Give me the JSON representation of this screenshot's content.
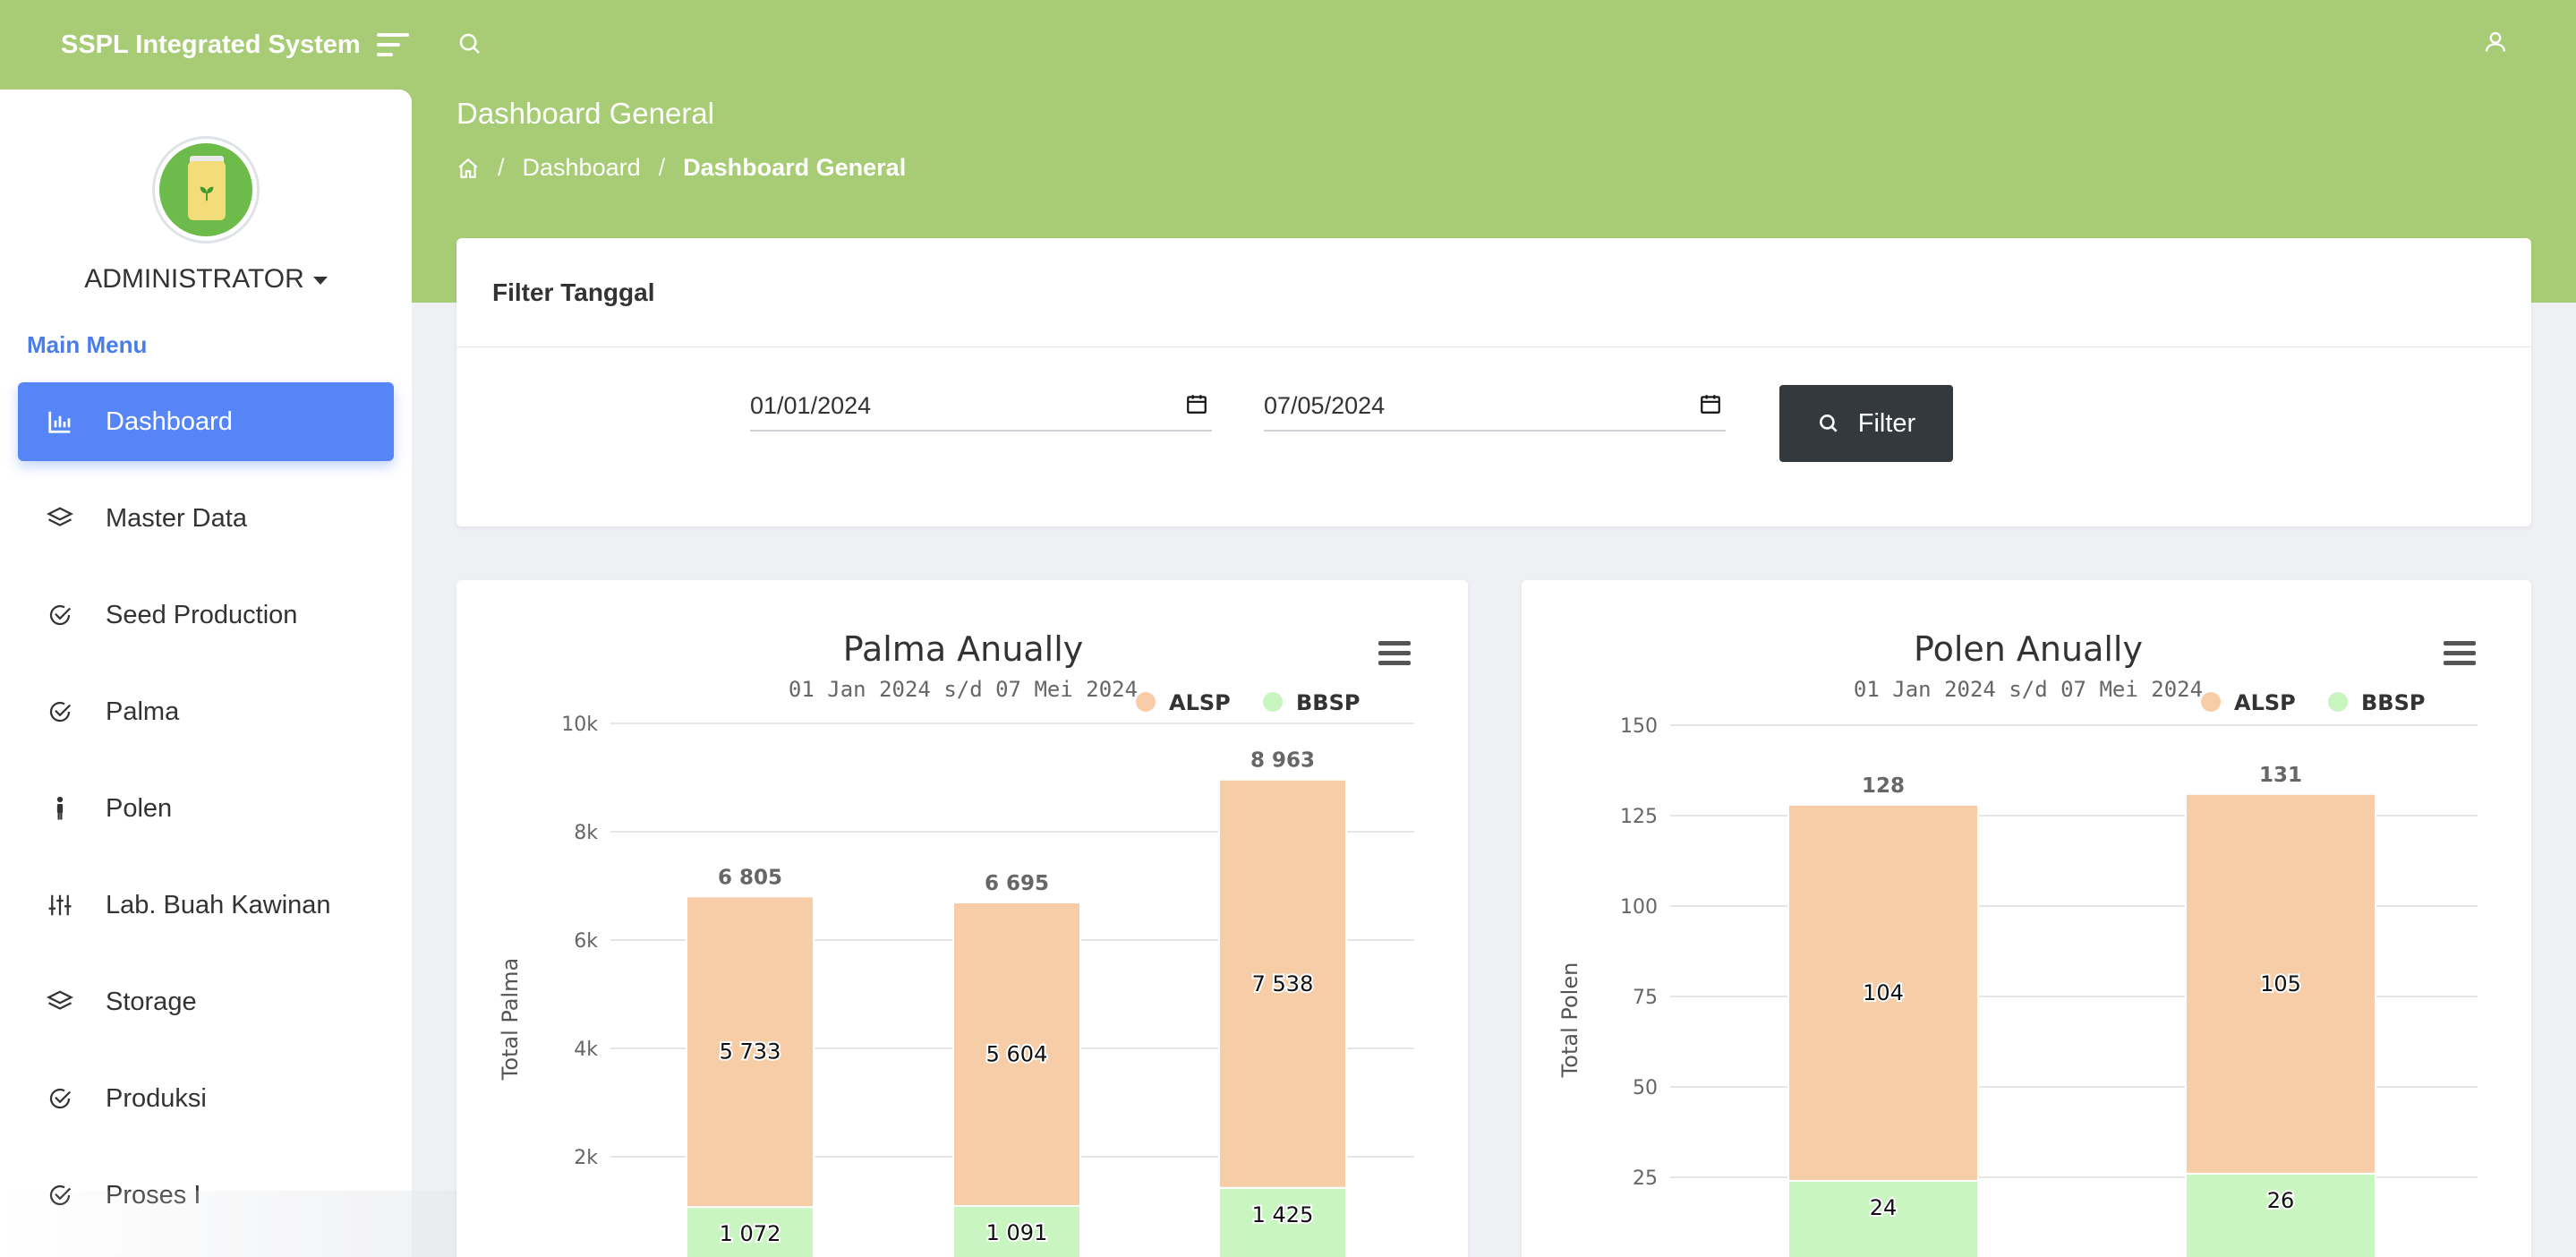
{
  "app": {
    "brand": "SSPL Integrated System"
  },
  "header": {
    "page_title": "Dashboard General",
    "breadcrumb": [
      "Dashboard",
      "Dashboard General"
    ]
  },
  "sidebar": {
    "user": "ADMINISTRATOR",
    "menu_title": "Main Menu",
    "items": [
      {
        "label": "Dashboard",
        "icon": "bar-chart-icon",
        "active": true
      },
      {
        "label": "Master Data",
        "icon": "layers-icon"
      },
      {
        "label": "Seed Production",
        "icon": "check-circle-icon"
      },
      {
        "label": "Palma",
        "icon": "check-circle-icon"
      },
      {
        "label": "Polen",
        "icon": "person-icon"
      },
      {
        "label": "Lab. Buah Kawinan",
        "icon": "sliders-icon"
      },
      {
        "label": "Storage",
        "icon": "layers-icon"
      },
      {
        "label": "Produksi",
        "icon": "check-circle-icon"
      },
      {
        "label": "Proses I",
        "icon": "check-circle-icon"
      }
    ]
  },
  "filter": {
    "title": "Filter Tanggal",
    "start_date": "01/01/2024",
    "end_date": "07/05/2024",
    "button_label": "Filter"
  },
  "colors": {
    "green_header": "#a7cc75",
    "accent": "#5585f6",
    "alsp": "#f7cda8",
    "bbsp": "#c9f5c0",
    "button_dark": "#34393e"
  },
  "chart_data": [
    {
      "type": "bar",
      "stacked": true,
      "title": "Palma Anually",
      "subtitle": "01 Jan 2024 s/d 07 Mei 2024",
      "ylabel": "Total Palma",
      "ylim": [
        0,
        10000
      ],
      "yticks": [
        "2k",
        "4k",
        "6k",
        "8k",
        "10k"
      ],
      "categories": [
        "",
        "",
        ""
      ],
      "series": [
        {
          "name": "ALSP",
          "values": [
            5733,
            5604,
            7538
          ],
          "labels": [
            "5 733",
            "5 604",
            "7 538"
          ]
        },
        {
          "name": "BBSP",
          "values": [
            1072,
            1091,
            1425
          ],
          "labels": [
            "1 072",
            "1 091",
            "1 425"
          ]
        }
      ],
      "totals": [
        "6 805",
        "6 695",
        "8 963"
      ],
      "legend": "top-right",
      "grid": true
    },
    {
      "type": "bar",
      "stacked": true,
      "title": "Polen Anually",
      "subtitle": "01 Jan 2024 s/d 07 Mei 2024",
      "ylabel": "Total Polen",
      "ylim": [
        0,
        150
      ],
      "yticks": [
        "25",
        "50",
        "75",
        "100",
        "125",
        "150"
      ],
      "categories": [
        "",
        ""
      ],
      "series": [
        {
          "name": "ALSP",
          "values": [
            104,
            105
          ],
          "labels": [
            "104",
            "105"
          ]
        },
        {
          "name": "BBSP",
          "values": [
            24,
            26
          ],
          "labels": [
            "24",
            "26"
          ]
        }
      ],
      "totals": [
        "128",
        "131"
      ],
      "legend": "top-right",
      "grid": true
    }
  ]
}
